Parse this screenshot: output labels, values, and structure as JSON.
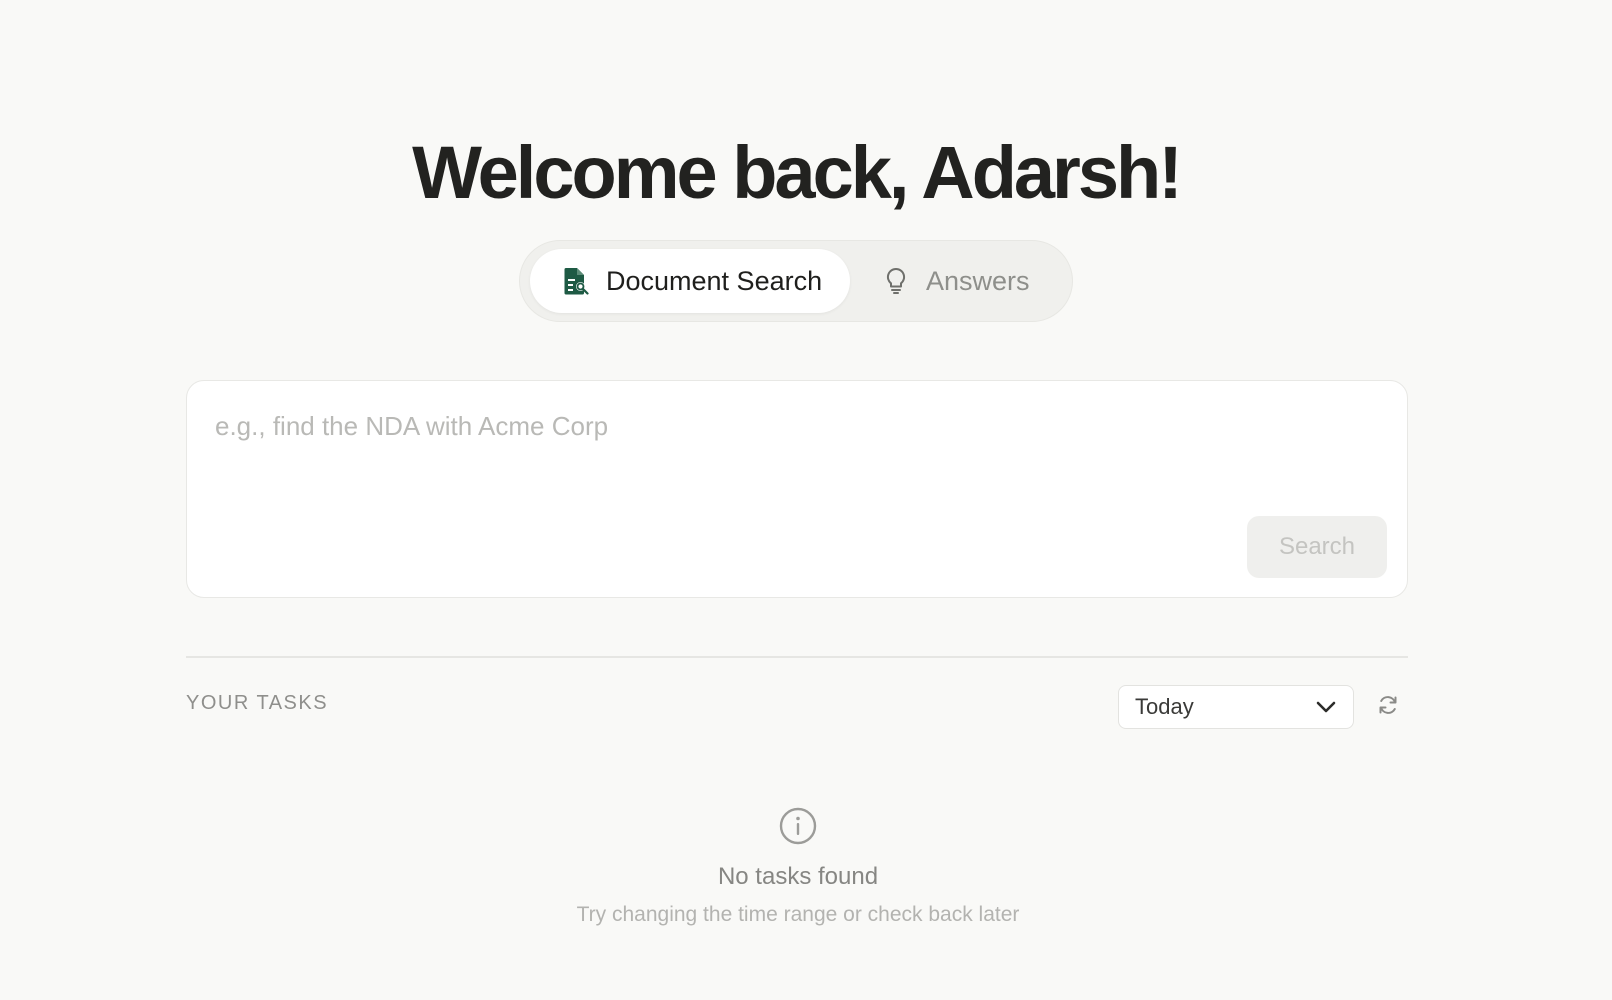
{
  "header": {
    "welcome": "Welcome back, Adarsh!"
  },
  "mode_toggle": {
    "tabs": [
      {
        "label": "Document Search",
        "icon": "document-search-icon",
        "active": true
      },
      {
        "label": "Answers",
        "icon": "lightbulb-icon",
        "active": false
      }
    ]
  },
  "search": {
    "placeholder": "e.g., find the NDA with Acme Corp",
    "value": "",
    "button_label": "Search"
  },
  "tasks": {
    "heading": "YOUR TASKS",
    "range": {
      "selected": "Today",
      "icon": "chevron-down-icon"
    },
    "refresh_icon": "refresh-icon",
    "empty": {
      "icon": "info-icon",
      "title": "No tasks found",
      "subtitle": "Try changing the time range or check back later"
    }
  },
  "colors": {
    "background": "#f9f9f7",
    "accent_green": "#1e5a44",
    "text_dark": "#222220",
    "muted": "#8e8f8b"
  }
}
